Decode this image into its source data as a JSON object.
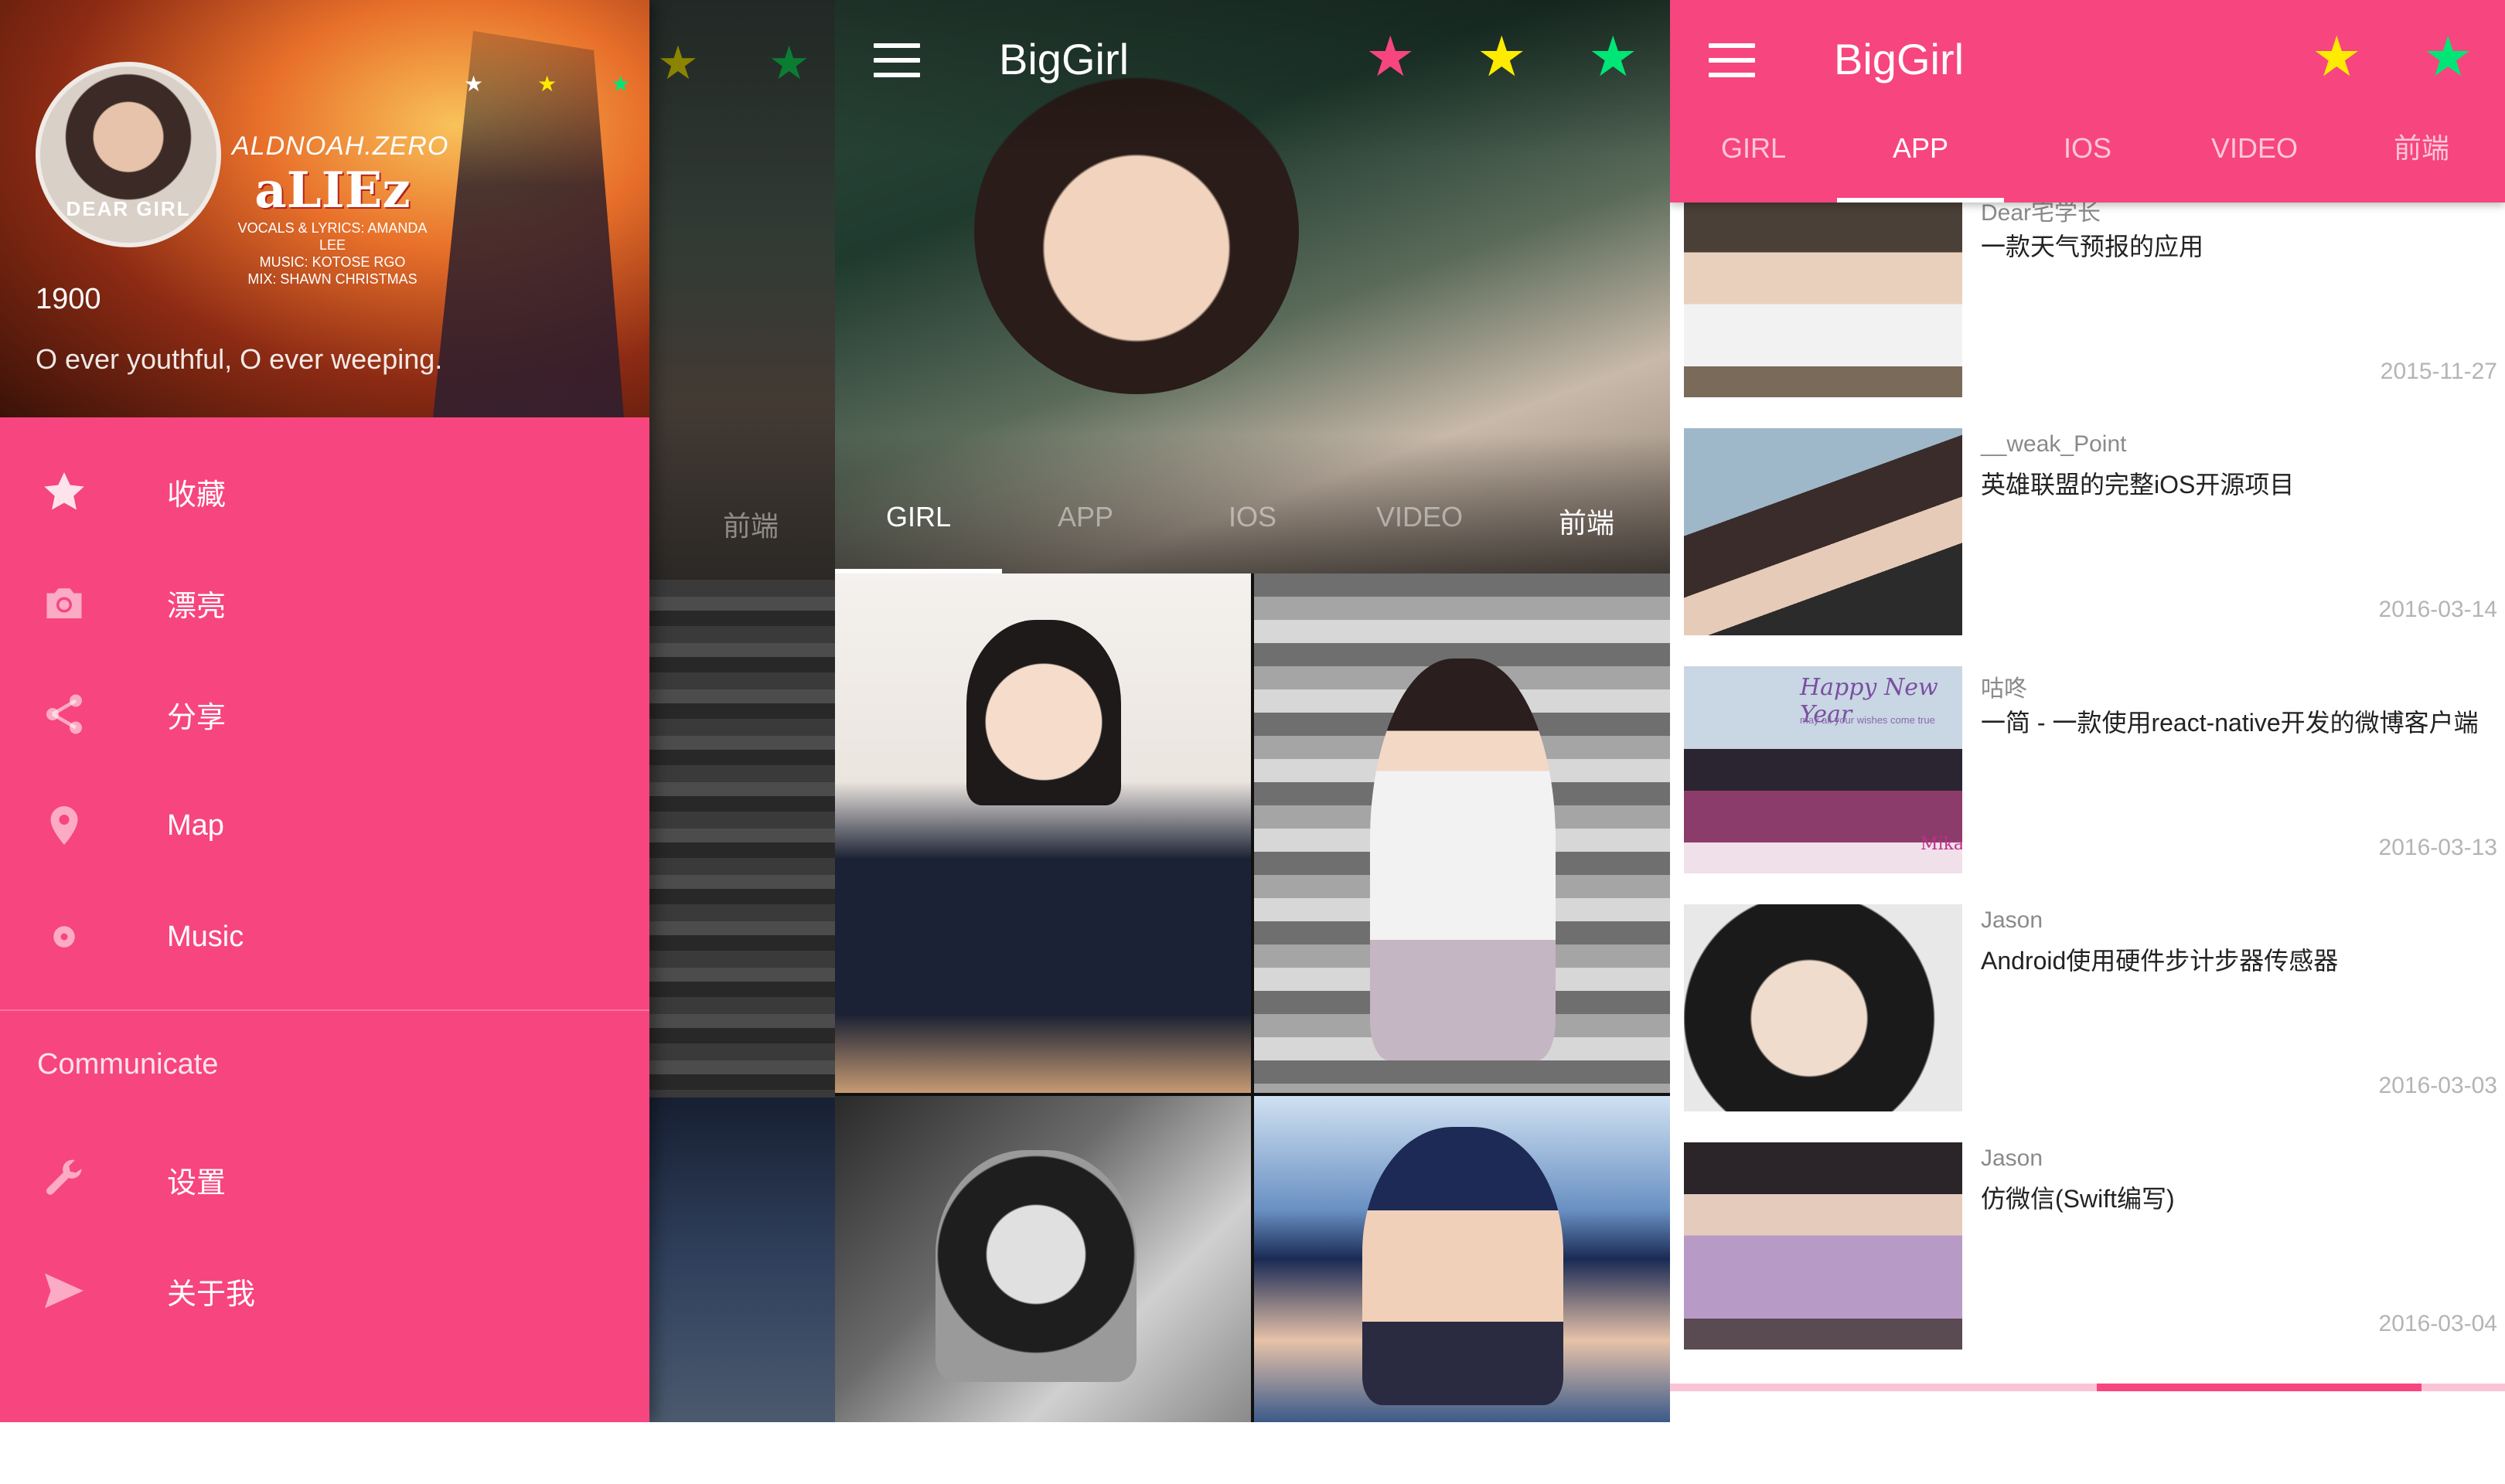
{
  "theme": {
    "accent": "#f7457f",
    "accent_light": "#fbc4d6",
    "white": "#ffffff",
    "star_pink": "#f7457f",
    "star_yellow": "#ffeb00",
    "star_green": "#00e676"
  },
  "app": {
    "title": "BigGirl"
  },
  "toolbar": {
    "menu_icon": "hamburger-icon",
    "stars": [
      "star-pink-icon",
      "star-yellow-icon",
      "star-green-icon"
    ]
  },
  "tabs": [
    {
      "label": "GIRL"
    },
    {
      "label": "APP"
    },
    {
      "label": "IOS"
    },
    {
      "label": "VIDEO"
    },
    {
      "label": "前端"
    }
  ],
  "drawer": {
    "header": {
      "name": "1900",
      "motto": "O ever youthful, O ever weeping.",
      "avatar_text": "DEAR GIRL",
      "artwork_title": "ALDNOAH.ZERO",
      "artwork_logo": "aLIEz",
      "artwork_credits": [
        "VOCALS & LYRICS: AMANDA LEE",
        "MUSIC: KOTOSE RGO",
        "MIX: SHAWN CHRISTMAS"
      ]
    },
    "items": [
      {
        "label": "收藏",
        "icon": "star-icon"
      },
      {
        "label": "漂亮",
        "icon": "camera-icon"
      },
      {
        "label": "分享",
        "icon": "share-icon"
      },
      {
        "label": "Map",
        "icon": "location-pin-icon"
      },
      {
        "label": "Music",
        "icon": "disc-icon"
      }
    ],
    "section_title": "Communicate",
    "section_items": [
      {
        "label": "设置",
        "icon": "wrench-icon"
      },
      {
        "label": "关于我",
        "icon": "send-icon"
      }
    ]
  },
  "screen2": {
    "active_tab": "GIRL",
    "peek_tab": "前端"
  },
  "screen3": {
    "active_tab": "APP",
    "list": [
      {
        "author": "Dear宅学长",
        "title": "一款天气预报的应用",
        "date": "2015-11-27"
      },
      {
        "author": "__weak_Point",
        "title": "英雄联盟的完整iOS开源项目",
        "date": "2016-03-14"
      },
      {
        "author": "咕咚",
        "title": "一简 - 一款使用react-native开发的微博客户端",
        "date": "2016-03-13",
        "thumb_caption": "Happy New Year",
        "thumb_subcaption": "may all your wishes come true",
        "thumb_signature": "Mika"
      },
      {
        "author": "Jason",
        "title": "Android使用硬件步计步器传感器",
        "date": "2016-03-03"
      },
      {
        "author": "Jason",
        "title": "仿微信(Swift编写)",
        "date": "2016-03-04"
      }
    ]
  }
}
